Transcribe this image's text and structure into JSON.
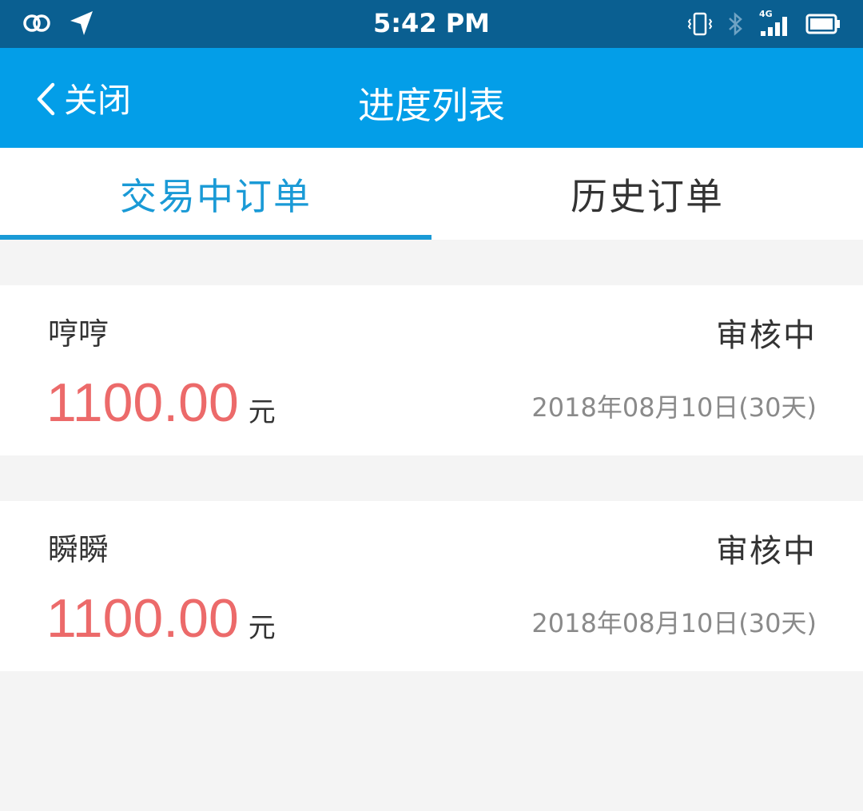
{
  "status_bar": {
    "time": "5:42 PM",
    "network": "4G",
    "icons": [
      "link-icon",
      "location-arrow-icon",
      "vibrate-icon",
      "bluetooth-icon",
      "signal-icon",
      "battery-icon"
    ]
  },
  "nav": {
    "back_label": "关闭",
    "title": "进度列表"
  },
  "tabs": [
    {
      "label": "交易中订单",
      "active": true
    },
    {
      "label": "历史订单",
      "active": false
    }
  ],
  "orders": [
    {
      "name": "哼哼",
      "status": "审核中",
      "amount": "1100.00",
      "unit": "元",
      "date": "2018年08月10日(30天)"
    },
    {
      "name": "瞬瞬",
      "status": "审核中",
      "amount": "1100.00",
      "unit": "元",
      "date": "2018年08月10日(30天)"
    }
  ],
  "colors": {
    "status_bar": "#0a5f91",
    "nav_bar": "#039ee8",
    "accent": "#1a9ad6",
    "amount": "#ec6a6a"
  }
}
